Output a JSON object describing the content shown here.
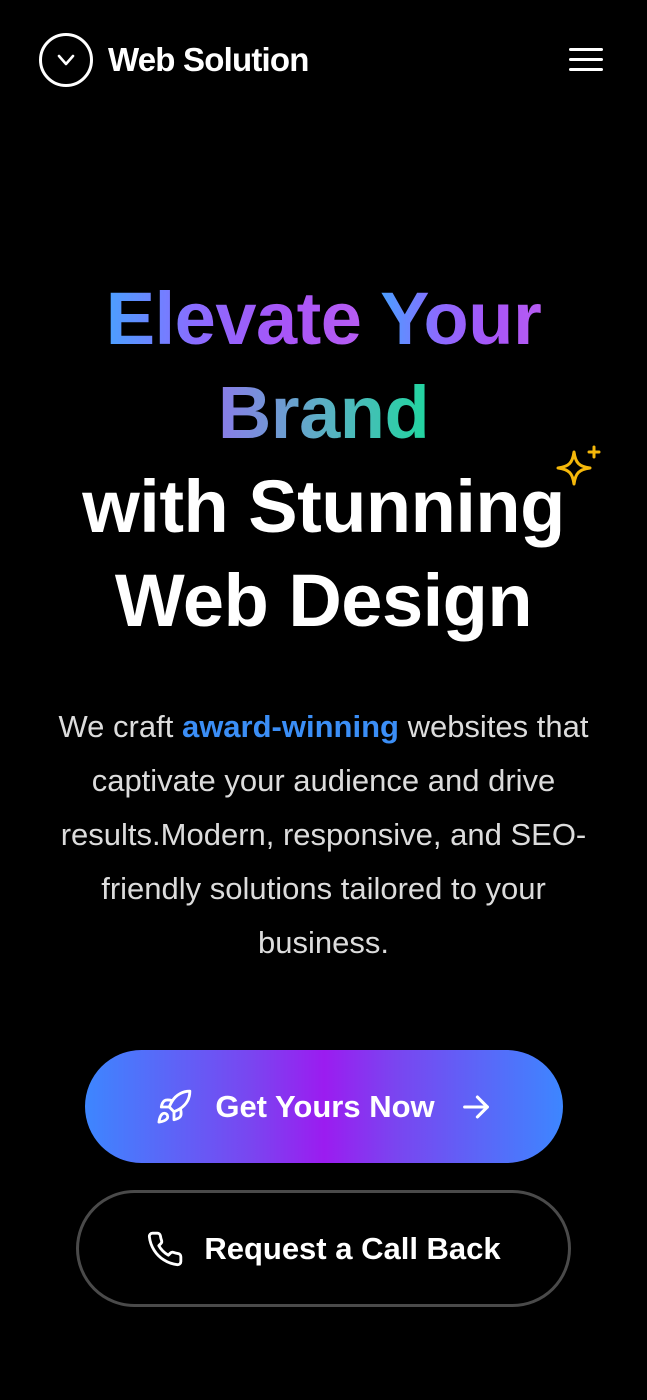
{
  "header": {
    "brand": "Web Solution",
    "logo_icon": "chevron-down-circle-icon",
    "menu_icon": "hamburger-menu-icon"
  },
  "hero": {
    "title_line1_part1": "Elevate",
    "title_line1_part2": "Your",
    "title_line2": "Brand",
    "title_line3": "with Stunning",
    "title_line4": "Web Design",
    "sparkle_icon": "sparkle-icon",
    "text_before": "We craft ",
    "text_highlight": "award-winning",
    "text_after": " websites that captivate your audience and drive results.Modern, responsive, and SEO-friendly solutions tailored to your business."
  },
  "cta": {
    "primary_label": "Get Yours Now",
    "primary_icon": "rocket-icon",
    "primary_arrow_icon": "arrow-right-icon",
    "secondary_label": "Request a Call Back",
    "secondary_icon": "phone-icon"
  },
  "colors": {
    "background": "#000000",
    "accent_blue": "#3b8ef6",
    "accent_purple": "#a855f7",
    "accent_green": "#21d6a0",
    "sparkle": "#f5b80a"
  }
}
